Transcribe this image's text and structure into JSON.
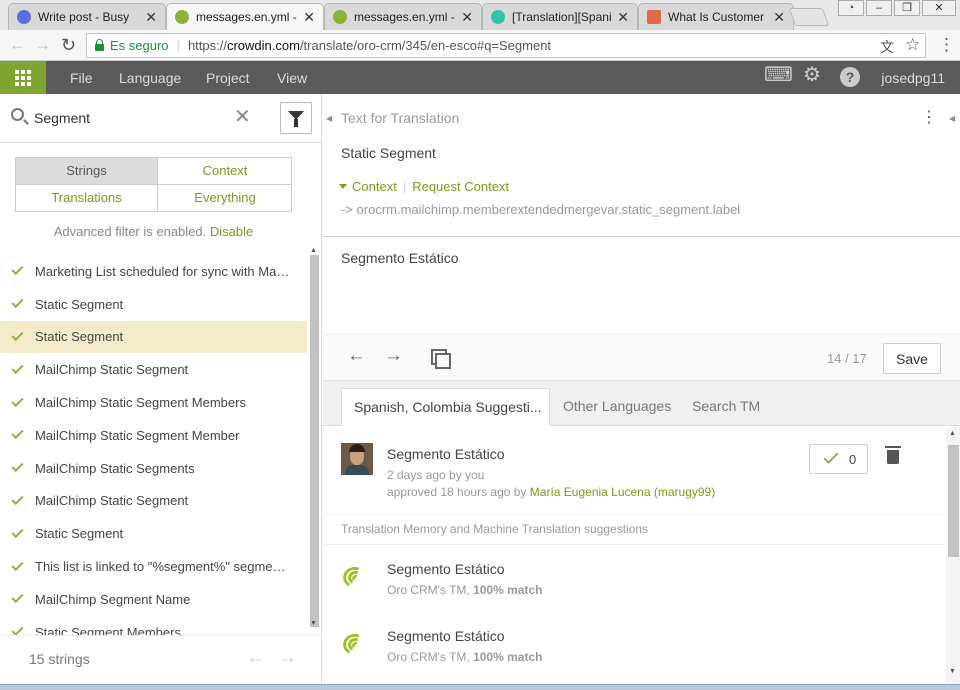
{
  "browser": {
    "tabs": [
      {
        "title": "Write post - Busy",
        "color": "#5b6ee1"
      },
      {
        "title": "messages.en.yml - C",
        "color": "#8ab33e"
      },
      {
        "title": "messages.en.yml - C",
        "color": "#8ab33e"
      },
      {
        "title": "[Translation][Spanis",
        "color": "#33c3a8"
      },
      {
        "title": "What Is Customer S",
        "color": "#e06a4a"
      }
    ],
    "close_glyph": "✕",
    "secure_label": "Es seguro",
    "url_prefix": "https://",
    "url_host": "crowdin.com",
    "url_path": "/translate/oro-crm/345/en-esco#q=Segment"
  },
  "app": {
    "menu": [
      "File",
      "Language",
      "Project",
      "View"
    ],
    "username": "josedpg11",
    "icons": [
      "keyboard-icon",
      "gear-icon",
      "help-icon"
    ]
  },
  "search": {
    "value": "Segment",
    "clear_glyph": "✕"
  },
  "filter_tabs": [
    "Strings",
    "Context",
    "Translations",
    "Everything"
  ],
  "advanced_filter": {
    "text": "Advanced filter is enabled.",
    "link": "Disable"
  },
  "strings": [
    "Marketing List scheduled for sync with Mail...",
    "Static Segment",
    "Static Segment",
    "MailChimp Static Segment",
    "MailChimp Static Segment Members",
    "MailChimp Static Segment Member",
    "MailChimp Static Segments",
    "MailChimp Static Segment",
    "Static Segment",
    "This list is linked to \"%segment%\" segment ...",
    "MailChimp Segment Name",
    "Static Segment Members"
  ],
  "strings_count": "15 strings",
  "editor": {
    "header": "Text for Translation",
    "source_text": "Static Segment",
    "context_label": "Context",
    "request_context_label": "Request Context",
    "context_key": "-> orocrm.mailchimp.memberextendedmergevar.static_segment.label",
    "translation": "Segmento Estático",
    "pager": "14 / 17",
    "save_label": "Save"
  },
  "suggestion_tabs": [
    "Spanish, Colombia Suggesti...",
    "Other Languages",
    "Search TM"
  ],
  "suggestion": {
    "text": "Segmento Estático",
    "time": "2 days ago by you",
    "approved_prefix": "approved 18 hours ago by",
    "approved_by": "María Eugenia Lucena (marugy99)",
    "votes": "0"
  },
  "tm_header": "Translation Memory and Machine Translation suggestions",
  "tm_suggestions": [
    {
      "text": "Segmento Estático",
      "source": "Oro CRM's TM,",
      "match": "100% match"
    },
    {
      "text": "Segmento Estático",
      "source": "Oro CRM's TM,",
      "match": "100% match"
    }
  ],
  "colors": {
    "accent_green": "#7fa531",
    "toolbar": "#5a5a5a",
    "selected_row": "#f4ebcb"
  }
}
